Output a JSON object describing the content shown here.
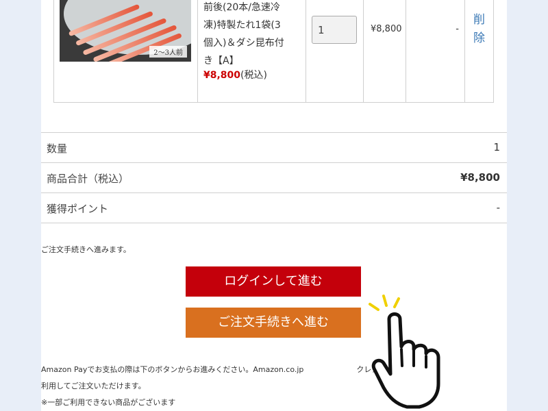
{
  "cart": {
    "thumb_caption": "2～3人前",
    "product_name": "前後(20本/急速冷\n凍)特製たれ1袋(3\n個入)＆ダシ昆布付\nき【A】",
    "product_price": "¥8,800",
    "product_price_suffix": "(税込)",
    "quantity": "1",
    "line_price": "¥8,800",
    "points": "-",
    "delete_label": "削除"
  },
  "summary": {
    "rows": [
      {
        "label": "数量",
        "value": "1"
      },
      {
        "label": "商品合計（税込）",
        "value": "¥8,800"
      },
      {
        "label": "獲得ポイント",
        "value": "-"
      }
    ]
  },
  "checkout": {
    "note": "ご注文手続きへ進みます。",
    "login_button": "ログインして進む",
    "order_button": "ご注文手続きへ進む"
  },
  "amazon": {
    "line1": "Amazon Payでお支払の際は下のボタンからお進みください。Amazon.co.jp　　　　　　　クレジットカード情報を",
    "line2": "利用してご注文いただけます。",
    "line3": "※一部ご利用できない商品がございます"
  },
  "colors": {
    "login_button": "#c4000b",
    "order_button": "#d9701f",
    "price_red": "#cc0000",
    "link_blue": "#3a78b5"
  },
  "icons": {
    "pointer": "hand-pointer-icon"
  }
}
